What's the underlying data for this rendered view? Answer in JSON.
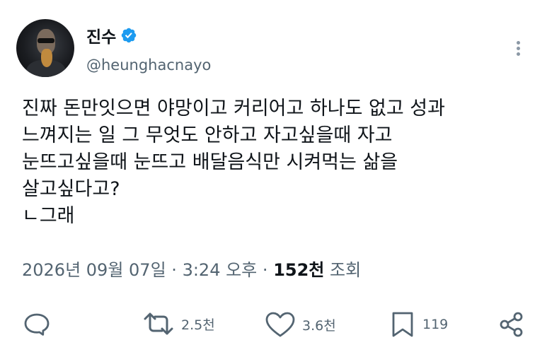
{
  "author": {
    "name": "진수",
    "handle": "@heunghacnayo"
  },
  "tweet": {
    "lines": [
      "진짜 돈만잇으면 야망이고 커리어고 하나도 없고 성과",
      "느껴지는 일 그 무엇도 안하고 자고싶을때 자고",
      "눈뜨고싶을때 눈뜨고 배달음식만 시켜먹는 삶을",
      "살고싶다고?",
      "ㄴ그래"
    ]
  },
  "meta": {
    "date": "2026년 09월 07일",
    "separator": "·",
    "time": "3:24 오후",
    "views_count": "152천",
    "views_label": "조회"
  },
  "actions": {
    "reply_count": "",
    "retweet_count": "2.5천",
    "like_count": "3.6천",
    "bookmark_count": "119"
  },
  "icons": {
    "verified": "verified-badge-icon",
    "more": "more-vertical-icon",
    "reply": "reply-icon",
    "retweet": "retweet-icon",
    "like": "heart-icon",
    "bookmark": "bookmark-icon",
    "share": "share-icon"
  },
  "colors": {
    "verified": "#1d9bf0",
    "text": "#0f1419",
    "secondary": "#536471"
  }
}
